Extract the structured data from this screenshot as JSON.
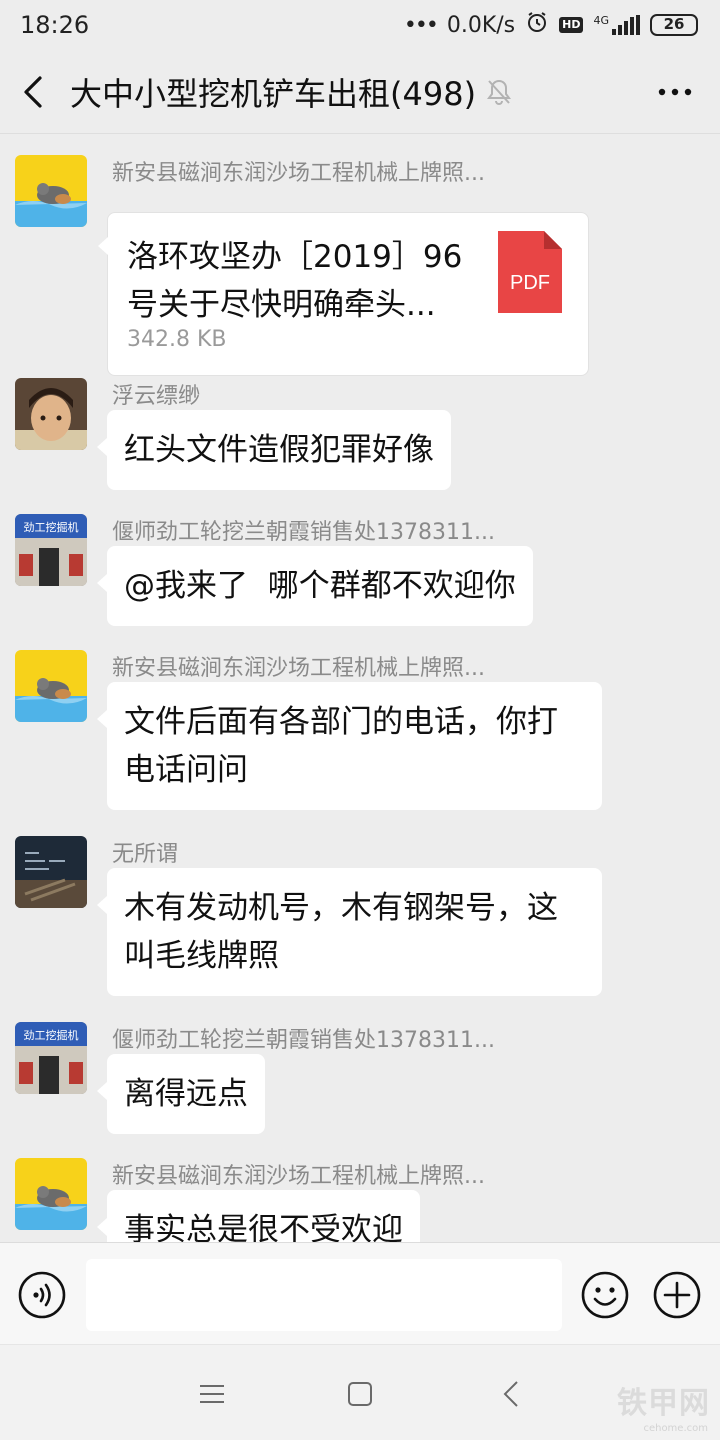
{
  "status_bar": {
    "time": "18:26",
    "net_speed": "0.0K/s",
    "hd_badge": "HD",
    "network_type": "4G",
    "battery": "26"
  },
  "header": {
    "title": "大中小型挖机铲车出租(498)"
  },
  "messages": [
    {
      "sender": "新安县磁涧东润沙场工程机械上牌照...",
      "type": "file",
      "file_name": "洛环攻坚办［2019］96号关于尽快明确牵头...",
      "file_size": "342.8 KB",
      "file_type": "PDF"
    },
    {
      "sender": "浮云缥缈",
      "text": "红头文件造假犯罪好像"
    },
    {
      "sender": "偃师劲工轮挖兰朝霞销售处1378311...",
      "text": "@我来了  哪个群都不欢迎你"
    },
    {
      "sender": "新安县磁涧东润沙场工程机械上牌照...",
      "text": "文件后面有各部门的电话，你打电话问问"
    },
    {
      "sender": "无所谓",
      "text": "木有发动机号，木有钢架号，这叫毛线牌照"
    },
    {
      "sender": "偃师劲工轮挖兰朝霞销售处1378311...",
      "text": "离得远点"
    },
    {
      "sender": "新安县磁涧东润沙场工程机械上牌照...",
      "text": "事实总是很不受欢迎"
    }
  ],
  "avatar_store_sign": "劲工挖掘机",
  "input": {
    "placeholder": "",
    "value": ""
  },
  "watermark": {
    "main": "铁甲网",
    "sub": "cehome.com"
  },
  "colors": {
    "background": "#ededed",
    "bubble": "#ffffff",
    "pdf": "#e84545"
  }
}
